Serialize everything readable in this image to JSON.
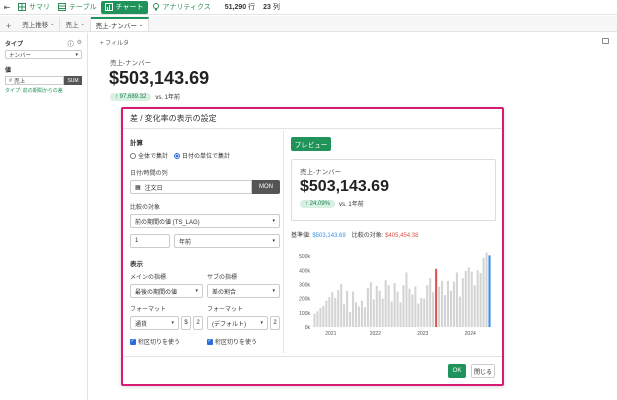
{
  "topbar": {
    "summary_label": "サマリ",
    "table_label": "テーブル",
    "chart_label": "チャート",
    "analytics_label": "アナリティクス",
    "row_count": "51,290",
    "row_unit": "行",
    "col_count": "23",
    "col_unit": "列"
  },
  "tabs": [
    {
      "label": "売上推移"
    },
    {
      "label": "売上"
    },
    {
      "label": "売上-ナンバー"
    }
  ],
  "sidebar": {
    "type_label": "タイプ",
    "type_value": "ナンバー",
    "value_label": "値",
    "value_name": "売上",
    "value_agg": "SUM",
    "value_note": "タイプ: 前の期間からの差"
  },
  "main": {
    "filter_label": "フィルタ",
    "card_title": "売上-ナンバー",
    "card_value": "$503,143.69",
    "card_change": "97,689.32",
    "card_period": "vs. 1年前"
  },
  "dialog": {
    "title": "差 / 変化率の表示の設定",
    "calc_label": "計算",
    "radio_all": "全体で集計",
    "radio_date": "日付の単位で集計",
    "date_col_label": "日付/時間の列",
    "date_col_value": "注文日",
    "date_unit": "MON",
    "compare_label": "比較の対象",
    "compare_value": "前の期間の値 (TS_LAG)",
    "lag_number": "1",
    "lag_unit": "年前",
    "display_label": "表示",
    "main_metric_label": "メインの指標",
    "sub_metric_label": "サブの指標",
    "main_metric_value": "最後の期間の値",
    "sub_metric_value": "差の割合",
    "format_label_1": "フォーマット",
    "format_label_2": "フォーマット",
    "format_value_1": "通貨",
    "format_currency": "$",
    "format_decimals_1": "2",
    "format_value_2": "(デフォルト)",
    "format_decimals_2": "2",
    "separator_1": "桁区切りを使う",
    "separator_2": "桁区切りを使う",
    "preview_button": "プレビュー",
    "preview_title": "売上-ナンバー",
    "preview_value": "$503,143.69",
    "preview_change": "24.09%",
    "preview_period": "vs. 1年前",
    "base_label": "基準値:",
    "base_value": "$503,143.69",
    "compare_target_label": "比較の対象:",
    "compare_target_value": "$405,454.38",
    "ok_button": "OK",
    "close_button": "閉じる"
  },
  "chart_data": {
    "type": "bar",
    "ylim": [
      0,
      550000
    ],
    "yticks": [
      "0k",
      "100k",
      "200k",
      "300k",
      "400k",
      "500k"
    ],
    "xticks": [
      "2021",
      "2022",
      "2023",
      "2024"
    ],
    "values": [
      95000,
      110000,
      135000,
      150000,
      185000,
      210000,
      245000,
      205000,
      260000,
      305000,
      160000,
      255000,
      105000,
      250000,
      175000,
      145000,
      185000,
      140000,
      275000,
      315000,
      195000,
      290000,
      255000,
      200000,
      330000,
      295000,
      180000,
      310000,
      250000,
      175000,
      295000,
      385000,
      270000,
      230000,
      285000,
      165000,
      205000,
      200000,
      295000,
      345000,
      245000,
      410000,
      285000,
      325000,
      225000,
      325000,
      255000,
      320000,
      385000,
      215000,
      345000,
      395000,
      420000,
      390000,
      295000,
      400000,
      380000,
      490000,
      525000,
      505000
    ],
    "highlight": {
      "compare_index": 41,
      "base_index": 59
    },
    "colors": {
      "bar": "#d4d4d4",
      "compare": "#e0524a",
      "base": "#3a8ee6"
    }
  }
}
